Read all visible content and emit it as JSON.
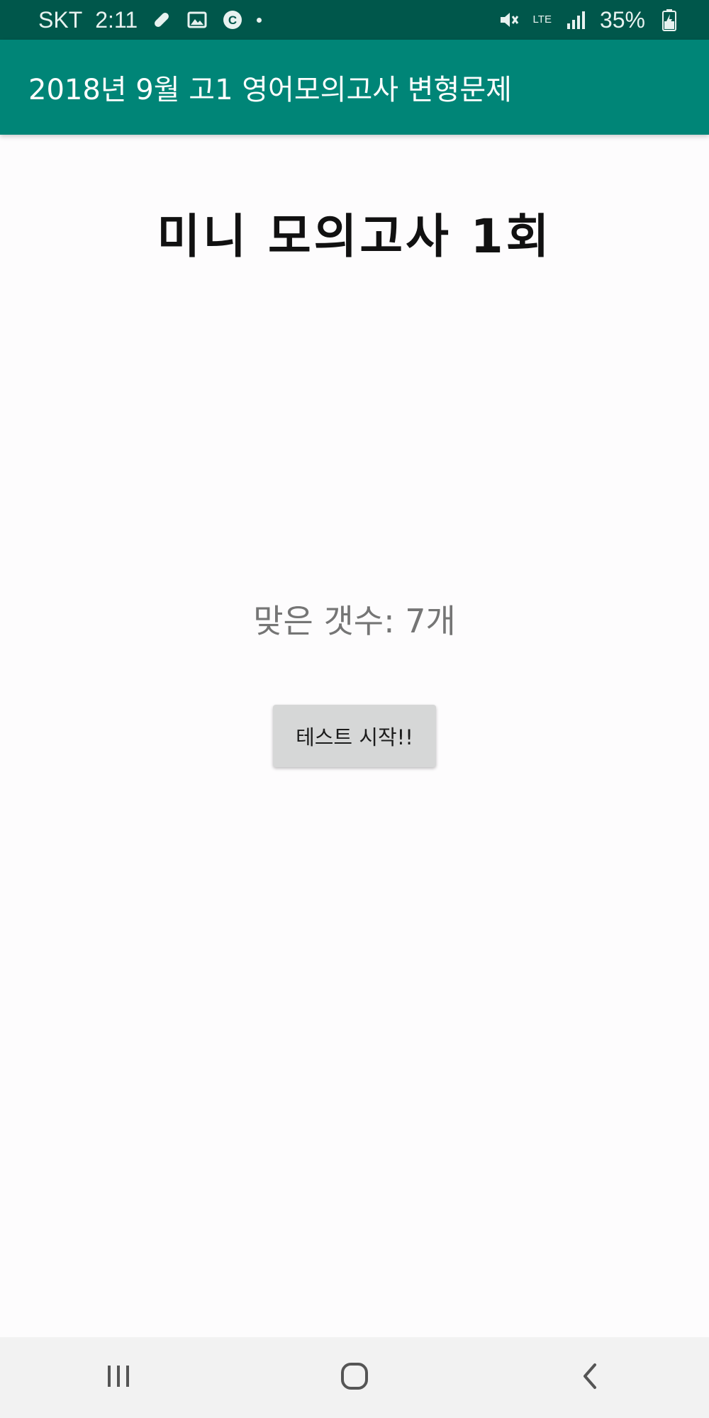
{
  "status_bar": {
    "carrier": "SKT",
    "time": "2:11",
    "network": "LTE",
    "battery": "35%",
    "icons": [
      "bandage-icon",
      "image-icon",
      "c-badge-icon",
      "dot-icon",
      "mute-icon",
      "lte-icon",
      "signal-icon",
      "battery-charging-icon"
    ]
  },
  "app_bar": {
    "title": "2018년 9월 고1 영어모의고사 변형문제"
  },
  "main": {
    "title": "미니 모의고사 1회",
    "score_text": "맞은 갯수: 7개",
    "start_button_label": "테스트 시작!!"
  },
  "nav_bar": {
    "icons": [
      "recent-apps-icon",
      "home-icon",
      "back-icon"
    ]
  },
  "colors": {
    "status_bar": "#00574b",
    "app_bar": "#008577",
    "background": "#fdfcfd",
    "button": "#d6d7d7",
    "nav_bar": "#f2f2f2"
  }
}
